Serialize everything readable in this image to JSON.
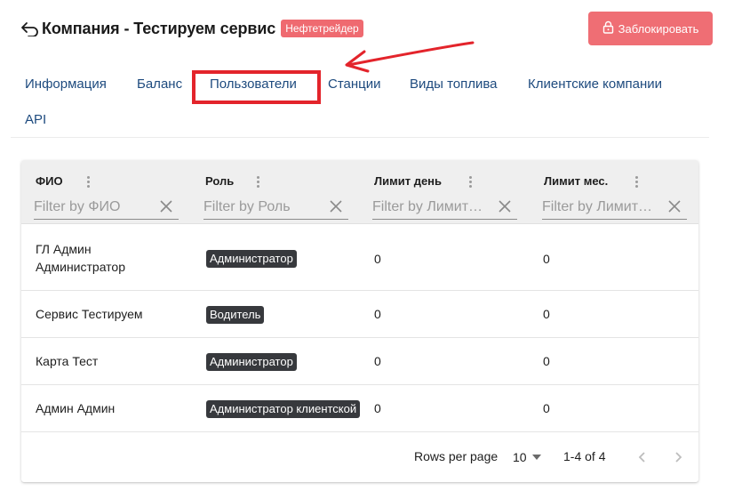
{
  "header": {
    "title": "Компания - Тестируем сервис",
    "badge": "Нефтетрейдер",
    "block_button_label": "Заблокировать"
  },
  "tabs": [
    {
      "label": "Информация"
    },
    {
      "label": "Баланс"
    },
    {
      "label": "Пользователи",
      "highlighted": true
    },
    {
      "label": "Станции"
    },
    {
      "label": "Виды топлива"
    },
    {
      "label": "Клиентские компании"
    },
    {
      "label": "API"
    }
  ],
  "table": {
    "columns": [
      {
        "title": "ФИО",
        "filter_placeholder": "Filter by ФИО"
      },
      {
        "title": "Роль",
        "filter_placeholder": "Filter by Роль"
      },
      {
        "title": "Лимит день",
        "filter_placeholder": "Filter by Лимит…"
      },
      {
        "title": "Лимит мес.",
        "filter_placeholder": "Filter by Лимит…"
      }
    ],
    "rows": [
      {
        "name_line1": "ГЛ Админ",
        "name_line2": "Администратор",
        "role": "Администратор",
        "limit_day": "0",
        "limit_month": "0"
      },
      {
        "name_line1": "Сервис Тестируем",
        "name_line2": "",
        "role": "Водитель",
        "limit_day": "0",
        "limit_month": "0"
      },
      {
        "name_line1": "Карта Тест",
        "name_line2": "",
        "role": "Администратор",
        "limit_day": "0",
        "limit_month": "0"
      },
      {
        "name_line1": "Админ Админ",
        "name_line2": "",
        "role": "Администратор клиентской",
        "limit_day": "0",
        "limit_month": "0"
      }
    ]
  },
  "pagination": {
    "rows_per_page_label": "Rows per page",
    "rows_per_page_value": "10",
    "range_label": "1-4 of 4"
  },
  "colors": {
    "accent": "#ef6e74",
    "tab_text": "#1d4a7e",
    "highlight_box": "#e3242b",
    "chip_bg": "#37393d"
  },
  "icons": [
    "back-arrow-icon",
    "lock-icon",
    "more-vert-icon",
    "close-icon",
    "chevron-down-icon",
    "chevron-left-icon",
    "chevron-right-icon"
  ]
}
